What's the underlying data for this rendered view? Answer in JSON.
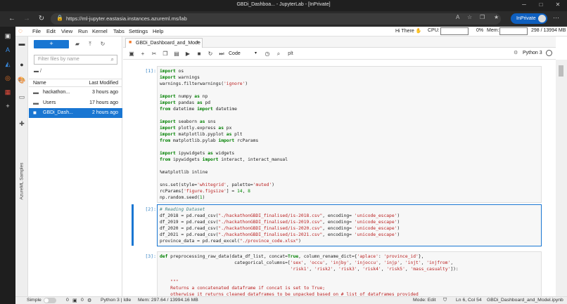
{
  "browser": {
    "window_title": "GBDi_Dashboa... - JupyterLab - [InPrivate]",
    "url": "https://ml-jupyter.eastasia.instances.azureml.ms/lab",
    "inprivate_label": "InPrivate"
  },
  "menubar": {
    "items": [
      "File",
      "Edit",
      "View",
      "Run",
      "Kernel",
      "Tabs",
      "Settings",
      "Help"
    ],
    "greeting": "Hi There",
    "cpu_label": "CPU:",
    "cpu_value": "0%",
    "mem_label": "Mem:",
    "mem_value": "298 / 13994 MB"
  },
  "activity_bar": {
    "vertical_label": "AzureML Samples"
  },
  "filebrowser": {
    "new_button": "+",
    "filter_placeholder": "Filter files by name",
    "breadcrumb": "/",
    "col_name": "Name",
    "col_modified": "Last Modified",
    "files": [
      {
        "name": "hackathon...",
        "modified": "3 hours ago",
        "icon": "folder-icon"
      },
      {
        "name": "Users",
        "modified": "17 hours ago",
        "icon": "folder-icon"
      },
      {
        "name": "GBDi_Dash...",
        "modified": "2 hours ago",
        "icon": "notebook-icon"
      }
    ]
  },
  "notebook": {
    "tab_title": "GBDi_Dashboard_and_Mode",
    "cell_type": "Code",
    "kernel": "Python 3",
    "toolbar_extra": "plt"
  },
  "cells": [
    {
      "prompt": "[1]:",
      "lines": [
        [
          [
            "kw",
            "import"
          ],
          [
            "t",
            " os"
          ]
        ],
        [
          [
            "kw",
            "import"
          ],
          [
            "t",
            " warnings"
          ]
        ],
        [
          [
            "t",
            "warnings.filterwarnings("
          ],
          [
            "str",
            "'ignore'"
          ],
          [
            "t",
            ")"
          ]
        ],
        [
          [
            "t",
            ""
          ]
        ],
        [
          [
            "kw",
            "import"
          ],
          [
            "t",
            " numpy "
          ],
          [
            "kw",
            "as"
          ],
          [
            "t",
            " np"
          ]
        ],
        [
          [
            "kw",
            "import"
          ],
          [
            "t",
            " pandas "
          ],
          [
            "kw",
            "as"
          ],
          [
            "t",
            " pd"
          ]
        ],
        [
          [
            "kw",
            "from"
          ],
          [
            "t",
            " datetime "
          ],
          [
            "kw",
            "import"
          ],
          [
            "t",
            " datetime"
          ]
        ],
        [
          [
            "t",
            ""
          ]
        ],
        [
          [
            "kw",
            "import"
          ],
          [
            "t",
            " seaborn "
          ],
          [
            "kw",
            "as"
          ],
          [
            "t",
            " sns"
          ]
        ],
        [
          [
            "kw",
            "import"
          ],
          [
            "t",
            " plotly.express "
          ],
          [
            "kw",
            "as"
          ],
          [
            "t",
            " px"
          ]
        ],
        [
          [
            "kw",
            "import"
          ],
          [
            "t",
            " matplotlib.pyplot "
          ],
          [
            "kw",
            "as"
          ],
          [
            "t",
            " plt"
          ]
        ],
        [
          [
            "kw",
            "from"
          ],
          [
            "t",
            " matplotlib.pylab "
          ],
          [
            "kw",
            "import"
          ],
          [
            "t",
            " rcParams"
          ]
        ],
        [
          [
            "t",
            ""
          ]
        ],
        [
          [
            "kw",
            "import"
          ],
          [
            "t",
            " ipywidgets "
          ],
          [
            "kw",
            "as"
          ],
          [
            "t",
            " widgets"
          ]
        ],
        [
          [
            "kw",
            "from"
          ],
          [
            "t",
            " ipywidgets "
          ],
          [
            "kw",
            "import"
          ],
          [
            "t",
            " interact, interact_manual"
          ]
        ],
        [
          [
            "t",
            ""
          ]
        ],
        [
          [
            "t",
            "%matplotlib inline"
          ]
        ],
        [
          [
            "t",
            ""
          ]
        ],
        [
          [
            "t",
            "sns.set(style="
          ],
          [
            "str",
            "'whitegrid'"
          ],
          [
            "t",
            ", palette="
          ],
          [
            "str",
            "'muted'"
          ],
          [
            "t",
            ")"
          ]
        ],
        [
          [
            "t",
            "rcParams["
          ],
          [
            "str",
            "'figure.figsize'"
          ],
          [
            "t",
            "] = "
          ],
          [
            "num",
            "14"
          ],
          [
            "t",
            ", "
          ],
          [
            "num",
            "8"
          ]
        ],
        [
          [
            "t",
            "np.random.seed("
          ],
          [
            "num",
            "1"
          ],
          [
            "t",
            ")"
          ]
        ]
      ]
    },
    {
      "prompt": "[2]:",
      "lines": [
        [
          [
            "cm",
            "# Reading Dataset"
          ]
        ],
        [
          [
            "t",
            "df_2018 = pd.read_csv("
          ],
          [
            "str",
            "\"./hackathonGBDI_finalised/is-2018.csv\""
          ],
          [
            "t",
            ", encoding= "
          ],
          [
            "str",
            "'unicode_escape'"
          ],
          [
            "t",
            ")"
          ]
        ],
        [
          [
            "t",
            "df_2019 = pd.read_csv("
          ],
          [
            "str",
            "\"./hackathonGBDI_finalised/is-2019.csv\""
          ],
          [
            "t",
            ", encoding= "
          ],
          [
            "str",
            "'unicode_escape'"
          ],
          [
            "t",
            ")"
          ]
        ],
        [
          [
            "t",
            "df_2020 = pd.read_csv("
          ],
          [
            "str",
            "\"./hackathonGBDI_finalised/is-2020.csv\""
          ],
          [
            "t",
            ", encoding= "
          ],
          [
            "str",
            "'unicode_escape'"
          ],
          [
            "t",
            ")"
          ]
        ],
        [
          [
            "t",
            "df_2021 = pd.read_csv("
          ],
          [
            "str",
            "\"./hackathonGBDI_finalised/is-2021.csv\""
          ],
          [
            "t",
            ", encoding= "
          ],
          [
            "str",
            "'unicode_escape'"
          ],
          [
            "t",
            ")"
          ]
        ],
        [
          [
            "t",
            "province_data = pd.read_excel("
          ],
          [
            "str",
            "\"./province_code.xlsx\""
          ],
          [
            "t",
            ")"
          ]
        ]
      ]
    },
    {
      "prompt": "[3]:",
      "lines": [
        [
          [
            "kw",
            "def"
          ],
          [
            "t",
            " preprocessing_raw_data(data_df_list, concat="
          ],
          [
            "kw",
            "True"
          ],
          [
            "t",
            ", column_rename_dict={"
          ],
          [
            "str",
            "'aplace'"
          ],
          [
            "t",
            ": "
          ],
          [
            "str",
            "'province_id'"
          ],
          [
            "t",
            "},"
          ]
        ],
        [
          [
            "t",
            "                            categorical_columns=["
          ],
          [
            "str",
            "'sex'"
          ],
          [
            "t",
            ", "
          ],
          [
            "str",
            "'occu'"
          ],
          [
            "t",
            ", "
          ],
          [
            "str",
            "'injby'"
          ],
          [
            "t",
            ", "
          ],
          [
            "str",
            "'injoccu'"
          ],
          [
            "t",
            ", "
          ],
          [
            "str",
            "'injp'"
          ],
          [
            "t",
            ", "
          ],
          [
            "str",
            "'injt'"
          ],
          [
            "t",
            ", "
          ],
          [
            "str",
            "'injfrom'"
          ],
          [
            "t",
            ","
          ]
        ],
        [
          [
            "t",
            "                                                 "
          ],
          [
            "str",
            "'risk1'"
          ],
          [
            "t",
            ", "
          ],
          [
            "str",
            "'risk2'"
          ],
          [
            "t",
            ", "
          ],
          [
            "str",
            "'risk3'"
          ],
          [
            "t",
            ", "
          ],
          [
            "str",
            "'risk4'"
          ],
          [
            "t",
            ", "
          ],
          [
            "str",
            "'risk5'"
          ],
          [
            "t",
            ", "
          ],
          [
            "str",
            "'mass_casualty'"
          ],
          [
            "t",
            "]):"
          ]
        ],
        [
          [
            "t",
            ""
          ]
        ],
        [
          [
            "str",
            "    \"\"\""
          ]
        ],
        [
          [
            "str",
            "    Returns a concatenated dataframe if concat is set to True;"
          ]
        ],
        [
          [
            "str",
            "    otherwise it returns cleaned dataframes to be unpacked based on # list of dataframes provided"
          ]
        ],
        [
          [
            "str",
            "    \"\"\""
          ]
        ]
      ]
    }
  ],
  "statusbar": {
    "simple_label": "Simple",
    "count_a": "0",
    "count_b": "0",
    "kernel_status": "Python 3 | Idle",
    "mem": "Mem: 297.64 / 13994.16 MB",
    "mode": "Mode: Edit",
    "cursor": "Ln 6, Col 54",
    "filename": "GBDi_Dashboard_and_Model.ipynb"
  }
}
